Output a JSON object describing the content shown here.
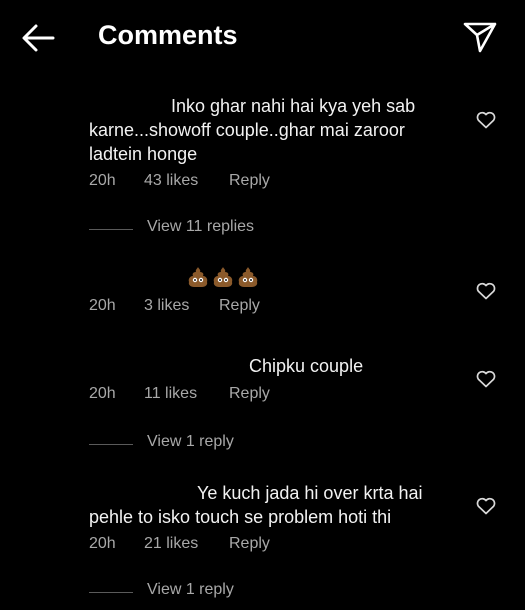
{
  "header": {
    "title": "Comments"
  },
  "comments": [
    {
      "lines": [
        "Inko ghar nahi hai kya yeh sab",
        "karne...showoff couple..ghar mai zaroor",
        "ladtein honge"
      ],
      "time": "20h",
      "likes": "43 likes",
      "reply": "Reply",
      "view_replies": "View 11 replies"
    },
    {
      "emoji": [
        "pile-of-poo",
        "pile-of-poo",
        "pile-of-poo"
      ],
      "time": "20h",
      "likes": "3 likes",
      "reply": "Reply"
    },
    {
      "lines": [
        "Chipku couple"
      ],
      "time": "20h",
      "likes": "11 likes",
      "reply": "Reply",
      "view_replies": "View 1 reply"
    },
    {
      "lines": [
        "Ye kuch jada hi over krta hai",
        "pehle to isko touch se problem hoti thi"
      ],
      "time": "20h",
      "likes": "21 likes",
      "reply": "Reply",
      "view_replies": "View 1 reply"
    }
  ],
  "colors": {
    "background": "#000000",
    "text": "#f2f2f2",
    "muted": "#a8a8a8",
    "emoji": "#8b5a2b"
  }
}
